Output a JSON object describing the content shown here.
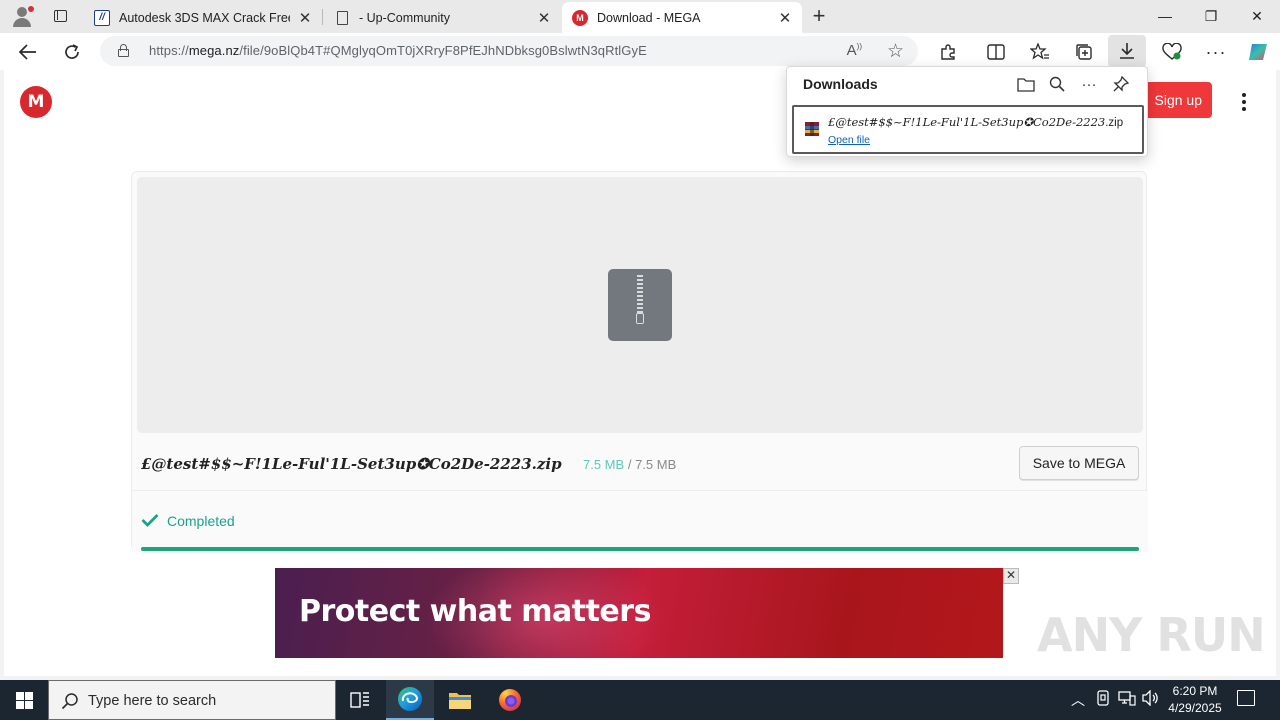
{
  "browser": {
    "tabs": [
      {
        "title": "Autodesk 3DS MAX Crack Free D…",
        "favicon": "3ds-max-favicon",
        "active": false
      },
      {
        "title": " - Up-Community",
        "favicon": "page-icon",
        "active": false
      },
      {
        "title": "Download - MEGA",
        "favicon": "mega-favicon",
        "active": true
      }
    ],
    "new_tab_symbol": "+",
    "close_symbol": "✕",
    "window_controls": {
      "minimize": "—",
      "restore": "❐",
      "close": "✕"
    },
    "address": {
      "scheme": "https://",
      "host": "mega.nz",
      "path": "/file/9oBlQb4T#QMglyqOmT0jXRryF8PfEJhNDbksg0BslwtN3qRtlGyE"
    }
  },
  "downloads_panel": {
    "title": "Downloads",
    "item": {
      "name_main": "£@test#$$~F!1Le-Ful'1L-Set3up✪Co2De-2223",
      "name_ext": ".zip",
      "action": "Open file"
    }
  },
  "page": {
    "logo_letter": "M",
    "signup_label": "Sign up",
    "file": {
      "name": "£@test#$$~F!1Le-Ful'1L-Set3up✪Co2De-2223.zip",
      "downloaded": "7.5 MB",
      "separator": "/",
      "total": "7.5 MB"
    },
    "save_label": "Save to MEGA",
    "status": "Completed",
    "progress_percent": 100,
    "ad": {
      "headline": "Protect what matters",
      "close": "✕"
    },
    "watermark": "ANY RUN"
  },
  "taskbar": {
    "search_placeholder": "Type here to search",
    "time": "6:20 PM",
    "date": "4/29/2025"
  },
  "colors": {
    "mega_red": "#d9272e",
    "status_green": "#1aa38c",
    "progress_green": "#20a37a"
  }
}
